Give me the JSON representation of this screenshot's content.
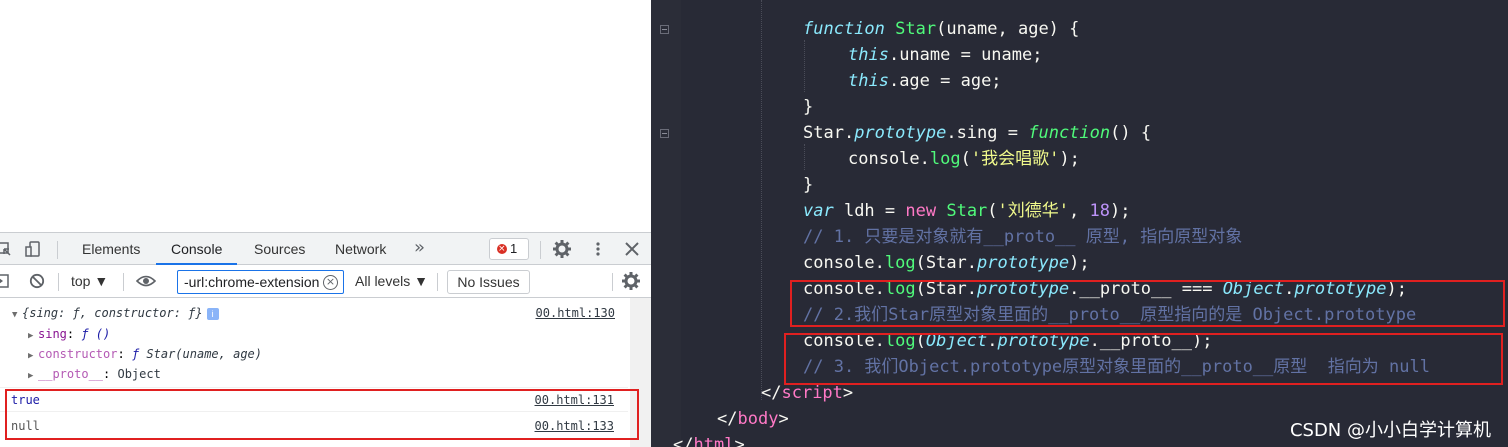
{
  "devtools": {
    "tabs": [
      {
        "label": "Elements"
      },
      {
        "label": "Console"
      },
      {
        "label": "Sources"
      },
      {
        "label": "Network"
      }
    ],
    "more_tabs": "»",
    "error_count": "1",
    "context": "top ▼",
    "filter_value": "-url:chrome-extension",
    "levels": "All levels ▼",
    "no_issues": "No Issues",
    "console": {
      "obj_summary": "{sing: ƒ, constructor: ƒ}",
      "obj_src": "00.html:130",
      "sing_key": "sing",
      "sing_val": "ƒ ()",
      "ctor_key": "constructor",
      "ctor_val_f": "ƒ",
      "ctor_val": "Star(uname, age)",
      "proto_key": "__proto__",
      "proto_val": "Object",
      "line_true": "true",
      "line_true_src": "00.html:131",
      "line_null": "null",
      "line_null_src": "00.html:133"
    }
  },
  "editor": {
    "watermark": "CSDN @小小白学计算机",
    "accent": "#e02020",
    "code": {
      "l1_fn": "function",
      "l1_name": "Star",
      "l1_rest": "(uname, age) {",
      "l2_this": "this",
      "l2_rest": ".uname = uname;",
      "l3_this": "this",
      "l3_rest": ".age = age;",
      "l4": "}",
      "l5_a": "Star.",
      "l5_proto": "prototype",
      "l5_b": ".",
      "l5_sing": "sing",
      "l5_c": " = ",
      "l5_fn": "function",
      "l5_d": "() {",
      "l6_a": "console.",
      "l6_log": "log",
      "l6_b": "(",
      "l6_str": "'我会唱歌'",
      "l6_c": ");",
      "l7": "}",
      "l8_var": "var",
      "l8_a": " ldh = ",
      "l8_new": "new",
      "l8_b": " ",
      "l8_star": "Star",
      "l8_c": "(",
      "l8_str": "'刘德华'",
      "l8_d": ", ",
      "l8_num": "18",
      "l8_e": ");",
      "l9_cmt": "// 1. 只要是对象就有__proto__ 原型, 指向原型对象",
      "l10_a": "console.",
      "l10_log": "log",
      "l10_b": "(Star.",
      "l10_proto": "prototype",
      "l10_c": ");",
      "l11_a": "console.",
      "l11_log": "log",
      "l11_b": "(Star.",
      "l11_proto": "prototype",
      "l11_c": ".__proto__ === ",
      "l11_obj": "Object",
      "l11_d": ".",
      "l11_proto2": "prototype",
      "l11_e": ");",
      "l12_cmt": "// 2.我们Star原型对象里面的__proto__原型指向的是 Object.prototype",
      "l13_a": "console.",
      "l13_log": "log",
      "l13_b": "(",
      "l13_obj": "Object",
      "l13_c": ".",
      "l13_proto": "prototype",
      "l13_d": ".__proto__);",
      "l14_cmt": "// 3. 我们Object.prototype原型对象里面的__proto__原型  指向为 null",
      "l15_open": "</",
      "l15_tag": "script",
      "l15_close": ">",
      "l16_open": "</",
      "l16_tag": "body",
      "l16_close": ">",
      "l17_open": "</",
      "l17_tag": "html",
      "l17_close": ">"
    }
  }
}
